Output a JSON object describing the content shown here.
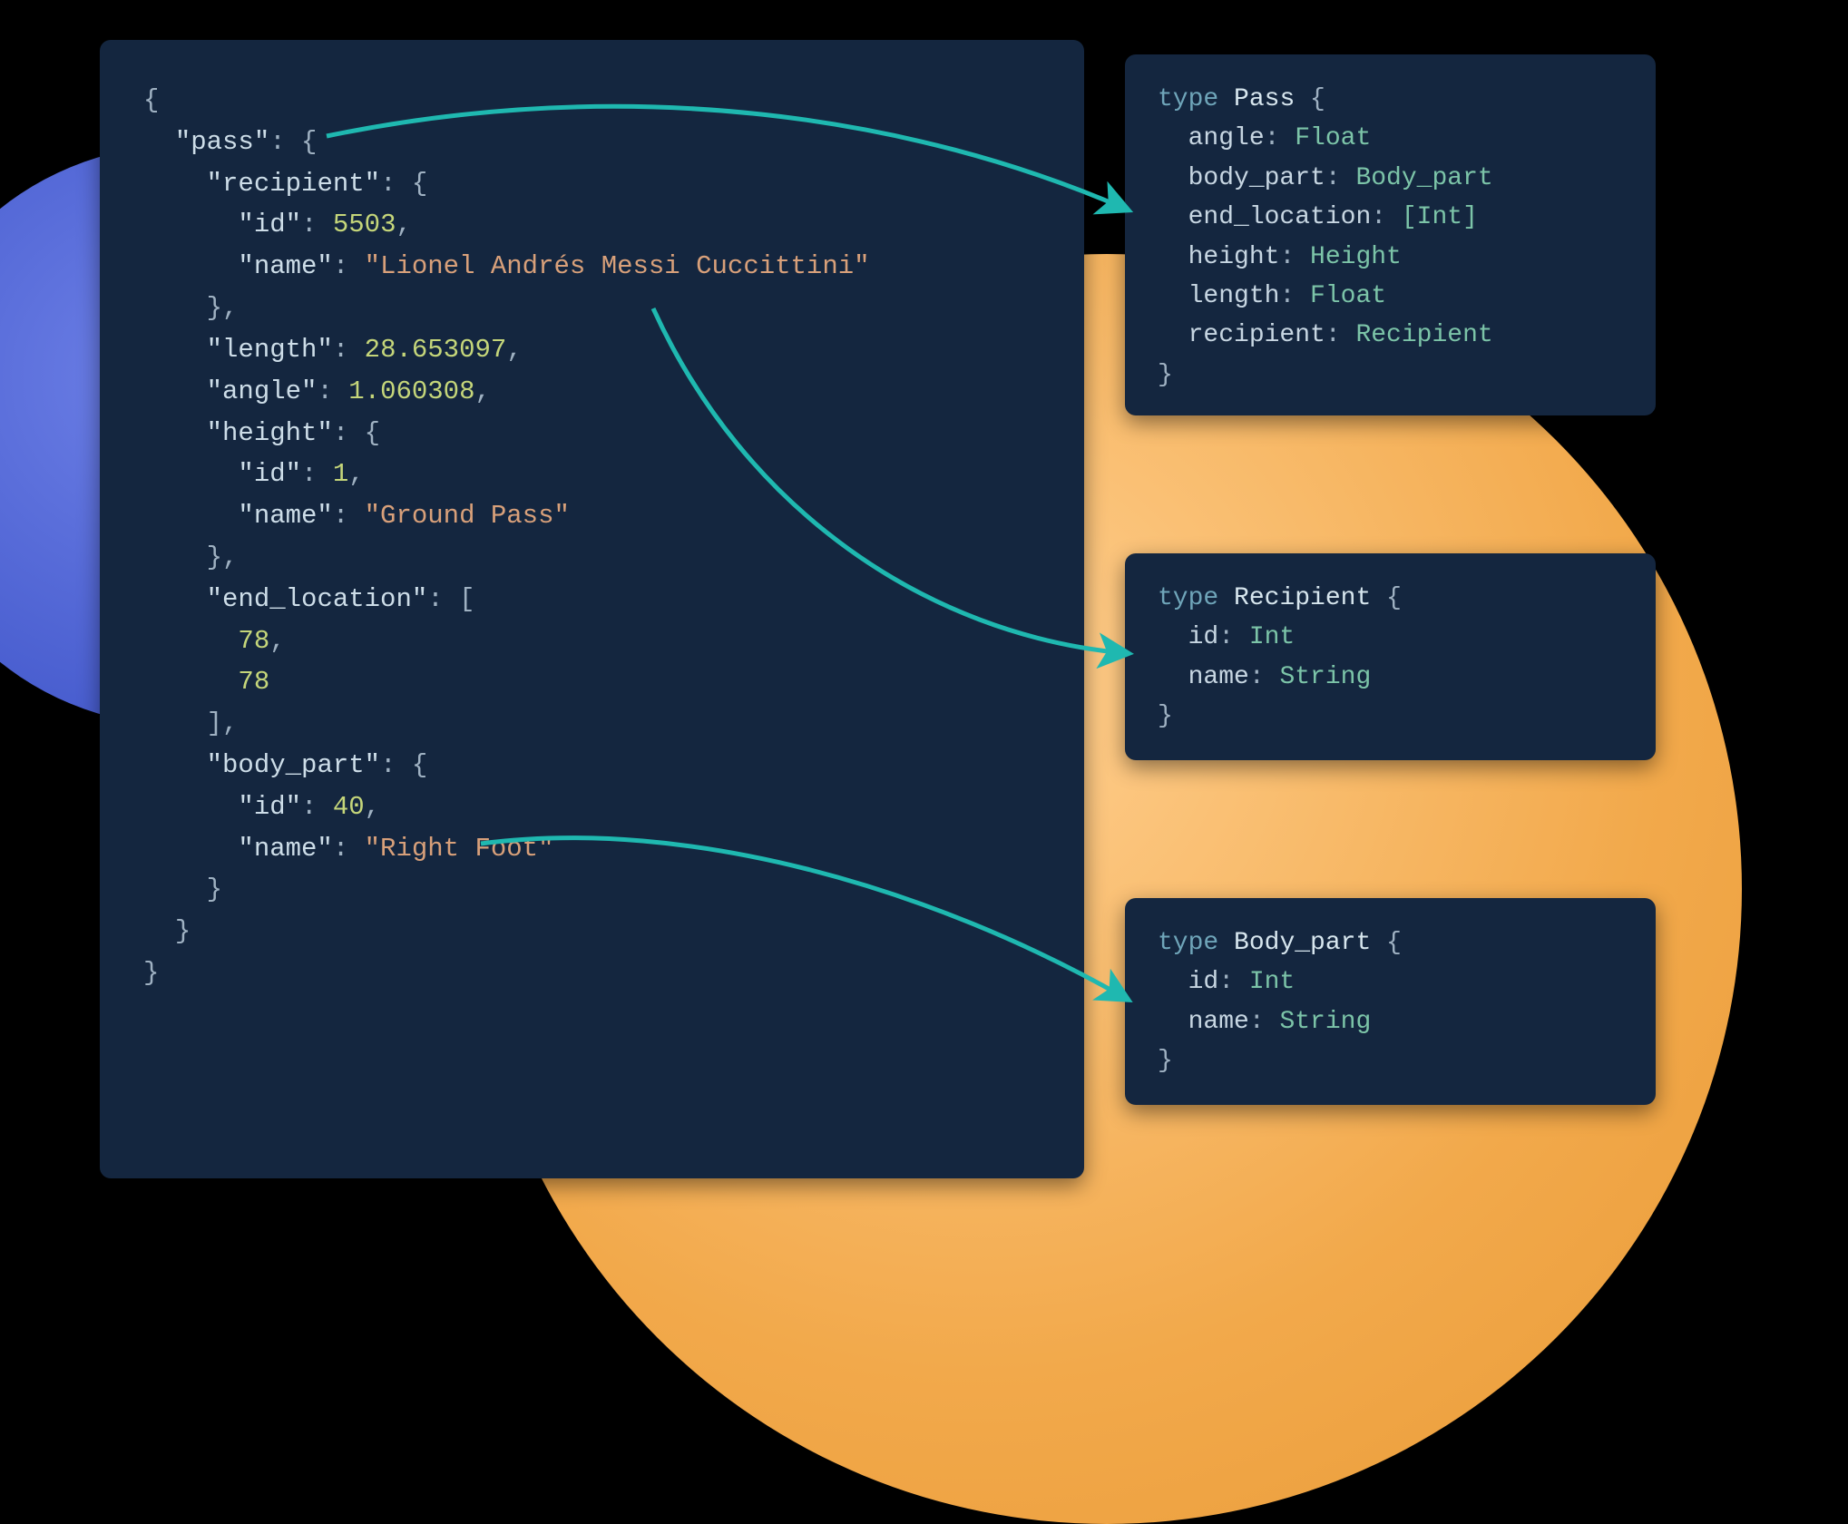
{
  "colors": {
    "panel_bg": "#14263f",
    "arrow": "#1fb8b0",
    "bg_orange": "#f2a94b",
    "bg_blue": "#4a5fd0",
    "keyword": "#6fa5b9",
    "type": "#7cc4a8",
    "string": "#d8a07a",
    "number": "#c5d67a"
  },
  "json": {
    "open": "{",
    "pass_key": "\"pass\"",
    "colon_open": ": {",
    "recipient_key": "\"recipient\"",
    "recipient_id_key": "\"id\"",
    "recipient_id_val": "5503",
    "recipient_name_key": "\"name\"",
    "recipient_name_val": "\"Lionel Andrés Messi Cuccittini\"",
    "close_comma": "},",
    "length_key": "\"length\"",
    "length_val": "28.653097",
    "angle_key": "\"angle\"",
    "angle_val": "1.060308",
    "height_key": "\"height\"",
    "height_id_key": "\"id\"",
    "height_id_val": "1",
    "height_name_key": "\"name\"",
    "height_name_val": "\"Ground Pass\"",
    "end_location_key": "\"end_location\"",
    "colon_arr": ": [",
    "end_loc_0": "78",
    "end_loc_1": "78",
    "arr_close_comma": "],",
    "body_part_key": "\"body_part\"",
    "body_part_id_key": "\"id\"",
    "body_part_id_val": "40",
    "body_part_name_key": "\"name\"",
    "body_part_name_val": "\"Right Foot\"",
    "close": "}",
    "comma": ",",
    "colon": ": "
  },
  "schema": {
    "keyword": "type",
    "pass": {
      "name": "Pass",
      "fields": [
        {
          "name": "angle",
          "type": "Float"
        },
        {
          "name": "body_part",
          "type": "Body_part"
        },
        {
          "name": "end_location",
          "type": "[Int]"
        },
        {
          "name": "height",
          "type": "Height"
        },
        {
          "name": "length",
          "type": "Float"
        },
        {
          "name": "recipient",
          "type": "Recipient"
        }
      ]
    },
    "recipient": {
      "name": "Recipient",
      "fields": [
        {
          "name": "id",
          "type": "Int"
        },
        {
          "name": "name",
          "type": "String"
        }
      ]
    },
    "body_part": {
      "name": "Body_part",
      "fields": [
        {
          "name": "id",
          "type": "Int"
        },
        {
          "name": "name",
          "type": "String"
        }
      ]
    },
    "open": " {",
    "close": "}",
    "colon": ": "
  }
}
